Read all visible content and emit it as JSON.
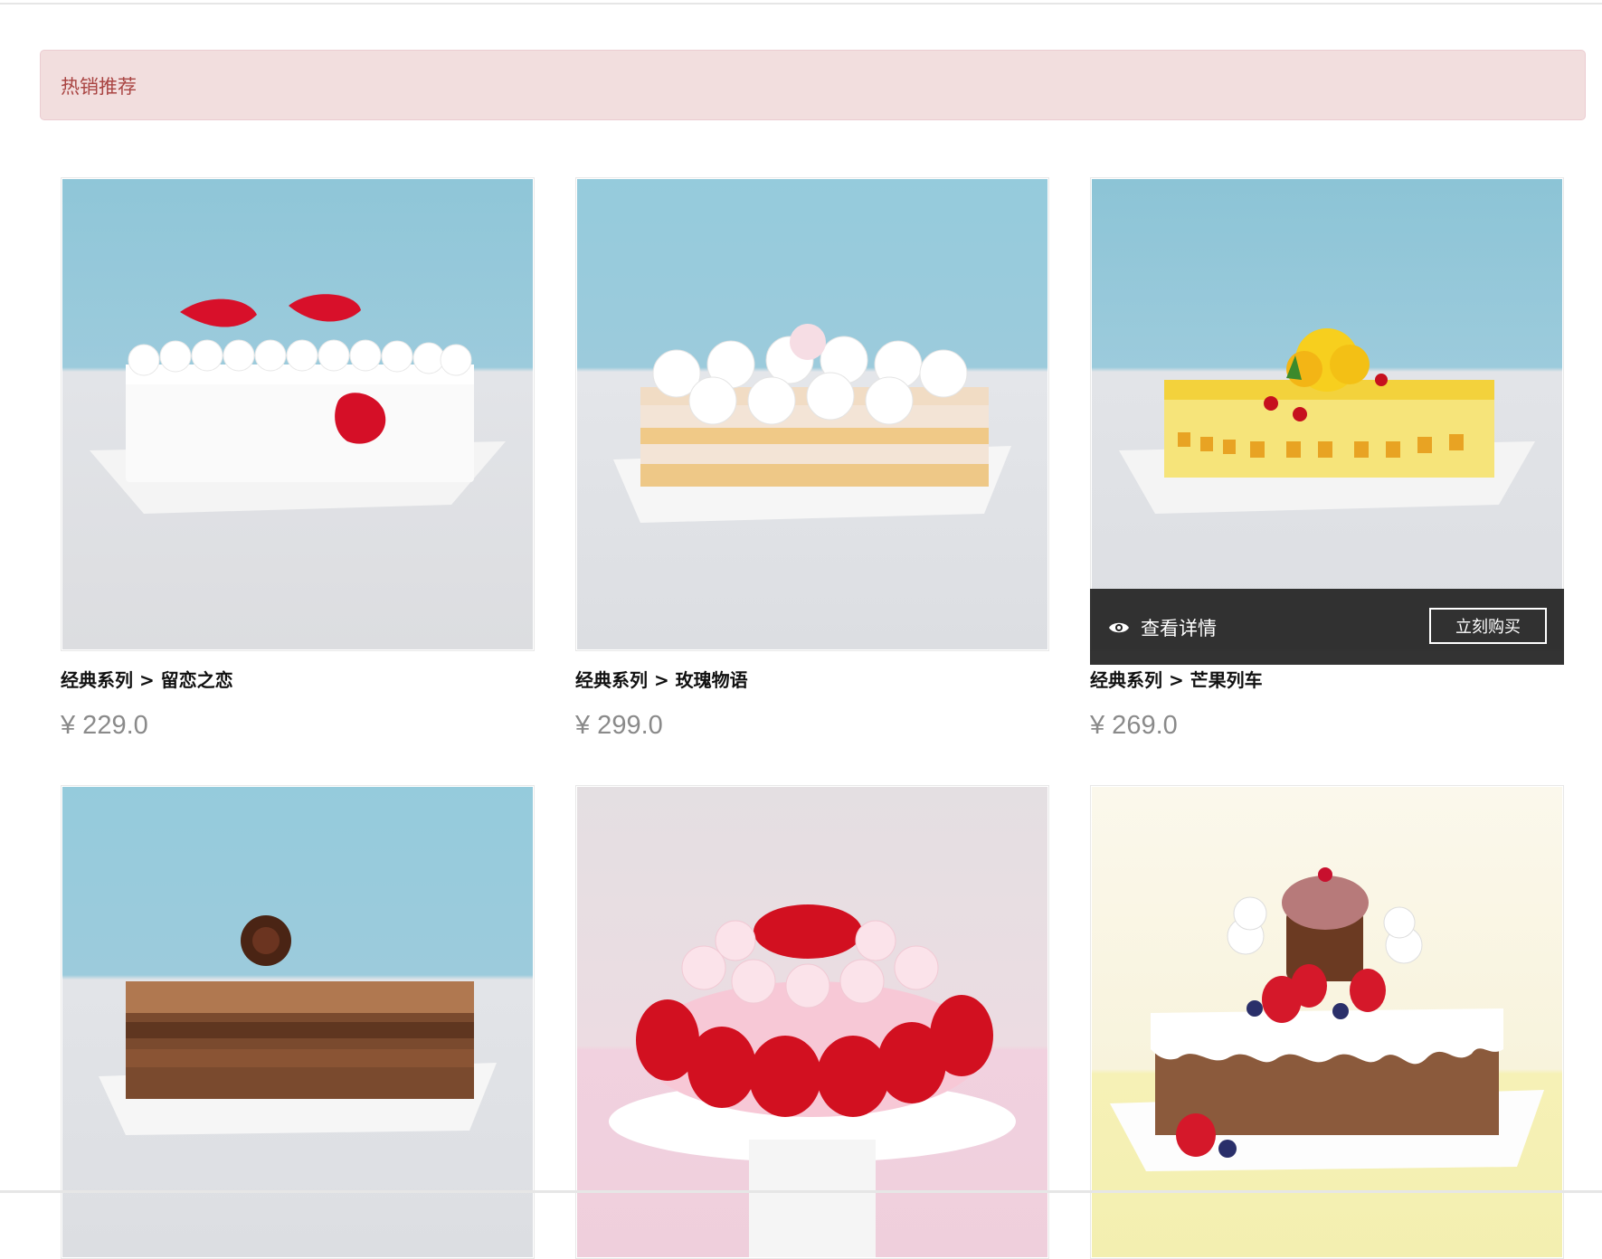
{
  "section": {
    "title": "热销推荐"
  },
  "products": [
    {
      "name": "经典系列 > 留恋之恋",
      "price": "¥ 229.0",
      "image": "white-cake-red-petals"
    },
    {
      "name": "经典系列 > 玫瑰物语",
      "price": "¥ 299.0",
      "image": "layered-cake-white-roses"
    },
    {
      "name": "经典系列 > 芒果列车",
      "price": "¥ 269.0",
      "image": "mango-cake"
    },
    {
      "name": "",
      "price": "",
      "image": "chocolate-cake-rose"
    },
    {
      "name": "",
      "price": "",
      "image": "round-cake-red-petals"
    },
    {
      "name": "",
      "price": "",
      "image": "kids-cake-bears-strawberries"
    }
  ],
  "hover_overlay": {
    "detail_label": "查看详情",
    "buy_label": "立刻购买",
    "icon": "eye-icon"
  },
  "colors": {
    "banner_bg": "#f2dede",
    "banner_text": "#a94442",
    "overlay_bg": "#222222",
    "price_text": "#8a8a8a"
  }
}
